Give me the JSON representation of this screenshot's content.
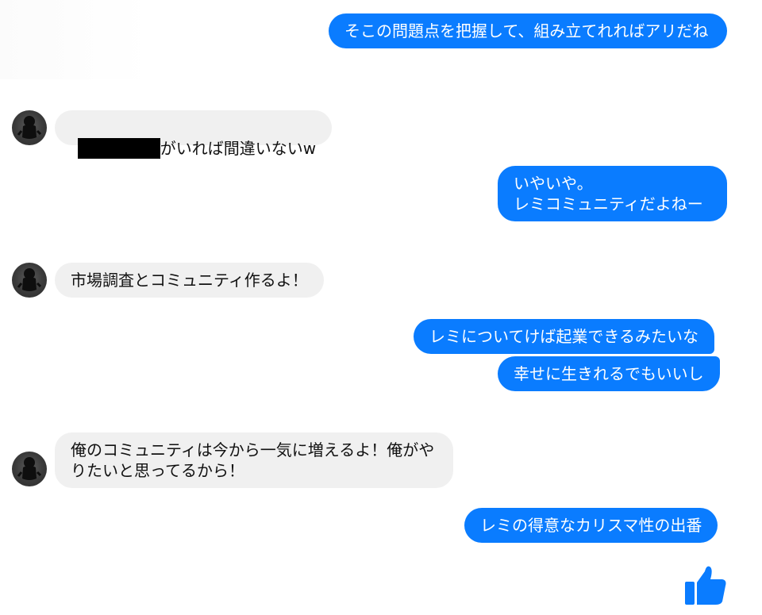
{
  "messages": [
    {
      "side": "out",
      "text": "そこの問題点を把握して、組み立てれればアリだね"
    },
    {
      "side": "in",
      "text": "がいれば間違いないw",
      "redacted": true
    },
    {
      "side": "out",
      "text": "いやいや。\nレミコミュニティだよねー"
    },
    {
      "side": "in",
      "text": "市場調査とコミュニティ作るよ！"
    },
    {
      "side": "out",
      "text": "レミについてけば起業できるみたいな"
    },
    {
      "side": "out",
      "text": "幸せに生きれるでもいいし"
    },
    {
      "side": "in",
      "text": "俺のコミュニティは今から一気に増えるよ！俺がやりたいと思ってるから！"
    },
    {
      "side": "out",
      "text": "レミの得意なカリスマ性の出番"
    }
  ],
  "colors": {
    "outgoing": "#0a7cff",
    "incoming": "#f0f0f0",
    "like": "#0a7cff"
  },
  "icons": {
    "avatar": "profile-avatar-icon",
    "like": "thumbs-up-icon",
    "redaction": "redaction-bar"
  }
}
